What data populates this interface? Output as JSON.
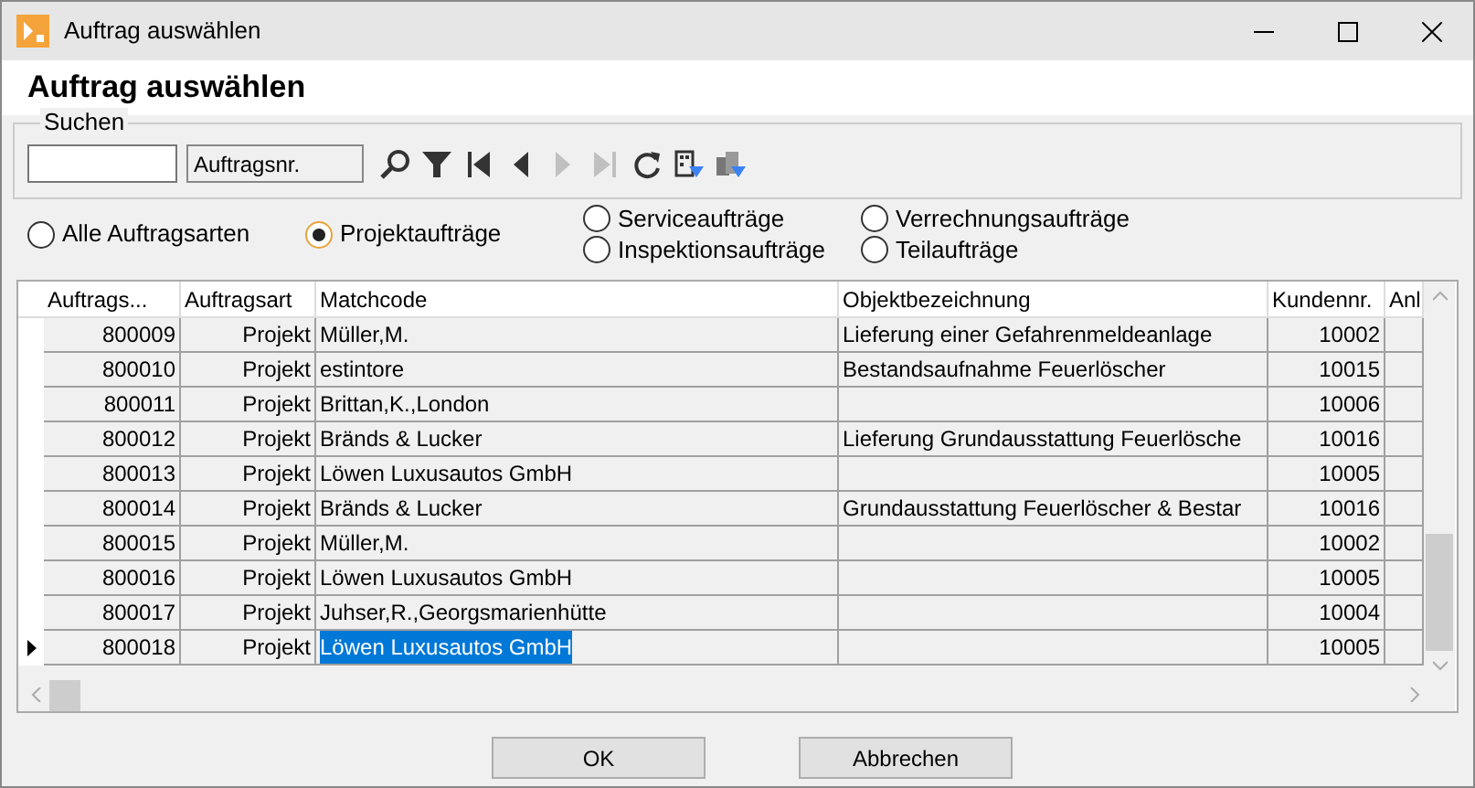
{
  "window": {
    "title": "Auftrag auswählen"
  },
  "heading": "Auftrag auswählen",
  "search": {
    "group_label": "Suchen",
    "field_name": "Auftragsnr."
  },
  "toolbar": [
    {
      "kind": "search",
      "disabled": false
    },
    {
      "kind": "filter",
      "disabled": false
    },
    {
      "kind": "first",
      "disabled": false
    },
    {
      "kind": "prev",
      "disabled": false
    },
    {
      "kind": "next",
      "disabled": true
    },
    {
      "kind": "last",
      "disabled": true
    },
    {
      "kind": "refresh",
      "disabled": false
    },
    {
      "kind": "building-filter",
      "disabled": false
    },
    {
      "kind": "buildings-filter",
      "disabled": false
    }
  ],
  "order_types": [
    {
      "label": "Alle Auftragsarten",
      "selected": false
    },
    {
      "label": "Projektaufträge",
      "selected": true
    },
    {
      "label": "Serviceaufträge",
      "selected": false
    },
    {
      "label": "Inspektionsaufträge",
      "selected": false
    },
    {
      "label": "Verrechnungsaufträge",
      "selected": false
    },
    {
      "label": "Teilaufträge",
      "selected": false
    }
  ],
  "table": {
    "columns": [
      "Auftrags...",
      "Auftragsart",
      "Matchcode",
      "Objektbezeichnung",
      "Kundennr.",
      "Anl"
    ],
    "rows": [
      {
        "cells": [
          "800009",
          "Projekt",
          "Müller,M.",
          "Lieferung einer Gefahrenmeldeanlage",
          "10002"
        ],
        "selected": false
      },
      {
        "cells": [
          "800010",
          "Projekt",
          "estintore",
          "Bestandsaufnahme Feuerlöscher",
          "10015"
        ],
        "selected": false
      },
      {
        "cells": [
          "800011",
          "Projekt",
          "Brittan,K.,London",
          "",
          "10006"
        ],
        "selected": false
      },
      {
        "cells": [
          "800012",
          "Projekt",
          "Bränds & Lucker",
          "Lieferung Grundausstattung Feuerlösche",
          "10016"
        ],
        "selected": false
      },
      {
        "cells": [
          "800013",
          "Projekt",
          "Löwen Luxusautos GmbH",
          "",
          "10005"
        ],
        "selected": false
      },
      {
        "cells": [
          "800014",
          "Projekt",
          "Bränds & Lucker",
          "Grundausstattung Feuerlöscher & Bestar",
          "10016"
        ],
        "selected": false
      },
      {
        "cells": [
          "800015",
          "Projekt",
          "Müller,M.",
          "",
          "10002"
        ],
        "selected": false
      },
      {
        "cells": [
          "800016",
          "Projekt",
          "Löwen Luxusautos GmbH",
          "",
          "10005"
        ],
        "selected": false
      },
      {
        "cells": [
          "800017",
          "Projekt",
          "Juhser,R.,Georgsmarienhütte",
          "",
          "10004"
        ],
        "selected": false
      },
      {
        "cells": [
          "800018",
          "Projekt",
          "Löwen Luxusautos GmbH",
          "",
          "10005"
        ],
        "selected": true
      }
    ]
  },
  "buttons": [
    "OK",
    "Abbrechen"
  ]
}
